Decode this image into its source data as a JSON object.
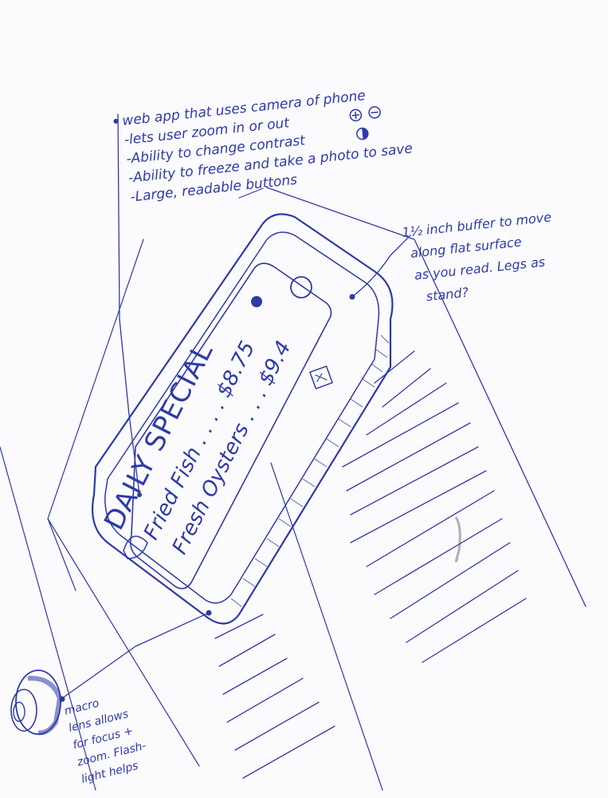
{
  "notes": [
    "web app that uses camera of phone",
    "-lets user zoom in or out",
    "-Ability to change contrast",
    "-Ability to freeze and take a photo to save",
    "-Large, readable buttons"
  ],
  "buffer_note": [
    "1½ inch buffer to move",
    "along flat surface",
    "as you read. Legs as",
    "stand?"
  ],
  "lens_note": [
    "macro",
    "lens allows",
    "for focus +",
    "zoom. Flash-",
    "light helps"
  ],
  "phone_screen": {
    "heading": "DAILY SPECIAL",
    "line1": "Fried Fish . . . . $8.75",
    "line2": "Fresh Oysters . . . $9.4"
  },
  "colors": {
    "ink": "#2e3aa8",
    "paper": "#fbfbfd"
  }
}
